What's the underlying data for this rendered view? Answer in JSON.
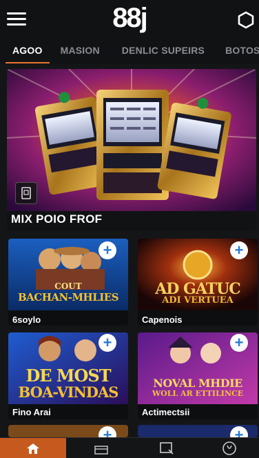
{
  "header": {
    "logo": "88j",
    "menu_icon": "hamburger-menu-icon",
    "right_icon": "hexagon-icon"
  },
  "tabs": [
    "AGOO",
    "MASION",
    "DENLIC SUPEIRS",
    "BOTOS"
  ],
  "active_tab": "AGOO",
  "banner": {
    "title": "MIX POIO FROF",
    "badge_icon": "phone-icon"
  },
  "games": [
    {
      "name": "6soylo",
      "art_text": [
        "COUT",
        "BACHAN-MHLIES"
      ]
    },
    {
      "name": "Capenois",
      "art_text": [
        "AD GATUC",
        "ADI VERTUEA"
      ]
    },
    {
      "name": "Fino Arai",
      "art_text": [
        "DE MOST",
        "BOA-VINDAS"
      ]
    },
    {
      "name": "Actimectsii",
      "art_text": [
        "NOVAL MHDIE",
        "WOLL AR ETTILINCE"
      ]
    }
  ],
  "add_button_label": "+",
  "bottom_nav": [
    "home-icon",
    "gift-icon",
    "chat-icon",
    "profile-icon"
  ],
  "colors": {
    "accent": "#e8762c",
    "nav_active": "#c65a1e",
    "background": "#141517",
    "plus_icon": "#2a7bd6"
  }
}
